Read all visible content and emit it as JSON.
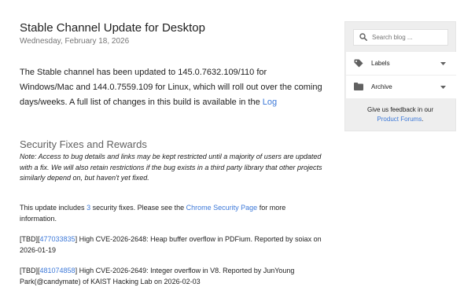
{
  "post": {
    "title": "Stable Channel Update for Desktop",
    "date": "Wednesday, February 18, 2026",
    "intro_text": "The Stable channel has been updated to 145.0.7632.109/110 for Windows/Mac and 144.0.7559.109 for Linux, which will roll out over the coming days/weeks. A full list of changes in this build is available in the ",
    "intro_link": "Log"
  },
  "security": {
    "heading": "Security Fixes and Rewards",
    "note": "Note: Access to bug details and links may be kept restricted until a majority of users are updated with a fix. We will also retain restrictions if the bug exists in a third party library that other projects similarly depend on, but haven't yet fixed.",
    "includes_prefix": "This update includes ",
    "count_link": "3",
    "includes_middle": " security fixes. Please see the ",
    "security_page_link": "Chrome Security Page",
    "includes_suffix": " for more information.",
    "fixes": [
      {
        "prefix": "[TBD][",
        "bug_id": "477033835",
        "description": "] High CVE-2026-2648: Heap buffer overflow in PDFium. Reported by soiax on 2026-01-19"
      },
      {
        "prefix": "[TBD][",
        "bug_id": "481074858",
        "description": "] High CVE-2026-2649: Integer overflow in V8. Reported by JunYoung Park(@candymate) of KAIST Hacking Lab on 2026-02-03"
      }
    ]
  },
  "sidebar": {
    "search_placeholder": "Search blog ...",
    "labels_label": "Labels",
    "archive_label": "Archive",
    "feedback_text": "Give us feedback in our",
    "feedback_link": "Product Forums",
    "feedback_end": "."
  },
  "colors": {
    "link": "#3c78d8",
    "text": "#212121",
    "muted": "#757575",
    "sidebar_bg": "#eeeeee"
  },
  "icons": [
    "search-icon",
    "label-icon",
    "folder-icon",
    "chevron-down-icon"
  ]
}
